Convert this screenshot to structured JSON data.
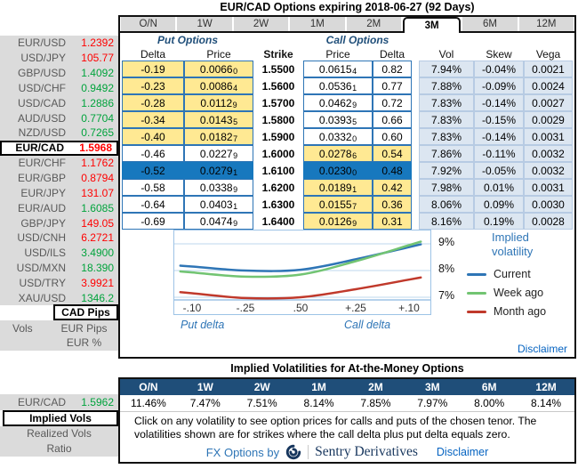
{
  "title": "EUR/CAD Options expiring 2018-06-27 (92 Days)",
  "colors": {
    "selected_row": "#1778BE",
    "itm_yellow": "#FFE993",
    "vol_panel": "#DCE6F1",
    "header_navy": "#1F4E79",
    "up_green": "#00A33C",
    "down_red": "#FF0000",
    "link_blue": "#0563C1"
  },
  "tenor_tabs": {
    "labels": [
      "O/N",
      "1W",
      "2W",
      "1M",
      "2M",
      "3M",
      "6M",
      "12M"
    ],
    "selected": "3M"
  },
  "sidebar": {
    "pairs": [
      {
        "pair": "EUR/USD",
        "rate": "1.2392",
        "dir": "red",
        "selected": false
      },
      {
        "pair": "USD/JPY",
        "rate": "105.77",
        "dir": "red",
        "selected": false
      },
      {
        "pair": "GBP/USD",
        "rate": "1.4092",
        "dir": "green",
        "selected": false
      },
      {
        "pair": "USD/CHF",
        "rate": "0.9492",
        "dir": "green",
        "selected": false
      },
      {
        "pair": "USD/CAD",
        "rate": "1.2886",
        "dir": "green",
        "selected": false
      },
      {
        "pair": "AUD/USD",
        "rate": "0.7704",
        "dir": "green",
        "selected": false
      },
      {
        "pair": "NZD/USD",
        "rate": "0.7265",
        "dir": "green",
        "selected": false
      },
      {
        "pair": "EUR/CAD",
        "rate": "1.5968",
        "dir": "red",
        "selected": true
      },
      {
        "pair": "EUR/CHF",
        "rate": "1.1762",
        "dir": "red",
        "selected": false
      },
      {
        "pair": "EUR/GBP",
        "rate": "0.8794",
        "dir": "red",
        "selected": false
      },
      {
        "pair": "EUR/JPY",
        "rate": "131.07",
        "dir": "red",
        "selected": false
      },
      {
        "pair": "EUR/AUD",
        "rate": "1.6085",
        "dir": "green",
        "selected": false
      },
      {
        "pair": "GBP/JPY",
        "rate": "149.05",
        "dir": "red",
        "selected": false
      },
      {
        "pair": "USD/CNH",
        "rate": "6.2721",
        "dir": "red",
        "selected": false
      },
      {
        "pair": "USD/ILS",
        "rate": "3.4900",
        "dir": "green",
        "selected": false
      },
      {
        "pair": "USD/MXN",
        "rate": "18.390",
        "dir": "green",
        "selected": false
      },
      {
        "pair": "USD/TRY",
        "rate": "3.9921",
        "dir": "red",
        "selected": false
      },
      {
        "pair": "XAU/USD",
        "rate": "1346.2",
        "dir": "green",
        "selected": false
      }
    ],
    "vols_label": "Vols",
    "quote_modes": {
      "selected": "CAD Pips",
      "others": [
        "EUR Pips",
        "EUR %"
      ]
    },
    "bottom_pair": {
      "pair": "EUR/CAD",
      "rate": "1.5962",
      "dir": "green"
    },
    "vol_views": {
      "selected": "Implied Vols",
      "others": [
        "Realized Vols",
        "Ratio"
      ]
    }
  },
  "options_table": {
    "put_group_label": "Put Options",
    "call_group_label": "Call Options",
    "headers": {
      "put_delta": "Delta",
      "put_price": "Price",
      "strike": "Strike",
      "call_price": "Price",
      "call_delta": "Delta",
      "vol": "Vol",
      "skew": "Skew",
      "vega": "Vega"
    },
    "rows": [
      {
        "put_delta": "-0.19",
        "put_price": "0.0066",
        "put_price_sub": "0",
        "strike": "1.5500",
        "call_price": "0.0615",
        "call_price_sub": "4",
        "call_delta": "0.82",
        "vol": "7.94%",
        "skew": "-0.04%",
        "vega": "0.0021",
        "put_itm": true,
        "call_itm": false,
        "selected": false
      },
      {
        "put_delta": "-0.23",
        "put_price": "0.0086",
        "put_price_sub": "4",
        "strike": "1.5600",
        "call_price": "0.0536",
        "call_price_sub": "1",
        "call_delta": "0.77",
        "vol": "7.88%",
        "skew": "-0.09%",
        "vega": "0.0024",
        "put_itm": true,
        "call_itm": false,
        "selected": false
      },
      {
        "put_delta": "-0.28",
        "put_price": "0.0112",
        "put_price_sub": "9",
        "strike": "1.5700",
        "call_price": "0.0462",
        "call_price_sub": "9",
        "call_delta": "0.72",
        "vol": "7.83%",
        "skew": "-0.14%",
        "vega": "0.0027",
        "put_itm": true,
        "call_itm": false,
        "selected": false
      },
      {
        "put_delta": "-0.34",
        "put_price": "0.0143",
        "put_price_sub": "5",
        "strike": "1.5800",
        "call_price": "0.0393",
        "call_price_sub": "5",
        "call_delta": "0.66",
        "vol": "7.83%",
        "skew": "-0.15%",
        "vega": "0.0029",
        "put_itm": true,
        "call_itm": false,
        "selected": false
      },
      {
        "put_delta": "-0.40",
        "put_price": "0.0182",
        "put_price_sub": "7",
        "strike": "1.5900",
        "call_price": "0.0332",
        "call_price_sub": "0",
        "call_delta": "0.60",
        "vol": "7.83%",
        "skew": "-0.14%",
        "vega": "0.0031",
        "put_itm": true,
        "call_itm": false,
        "selected": false
      },
      {
        "put_delta": "-0.46",
        "put_price": "0.0227",
        "put_price_sub": "9",
        "strike": "1.6000",
        "call_price": "0.0278",
        "call_price_sub": "6",
        "call_delta": "0.54",
        "vol": "7.86%",
        "skew": "-0.11%",
        "vega": "0.0032",
        "put_itm": false,
        "call_itm": true,
        "selected": false
      },
      {
        "put_delta": "-0.52",
        "put_price": "0.0279",
        "put_price_sub": "1",
        "strike": "1.6100",
        "call_price": "0.0230",
        "call_price_sub": "0",
        "call_delta": "0.48",
        "vol": "7.92%",
        "skew": "-0.05%",
        "vega": "0.0032",
        "put_itm": false,
        "call_itm": false,
        "selected": true
      },
      {
        "put_delta": "-0.58",
        "put_price": "0.0338",
        "put_price_sub": "9",
        "strike": "1.6200",
        "call_price": "0.0189",
        "call_price_sub": "1",
        "call_delta": "0.42",
        "vol": "7.98%",
        "skew": "0.01%",
        "vega": "0.0031",
        "put_itm": false,
        "call_itm": true,
        "selected": false
      },
      {
        "put_delta": "-0.64",
        "put_price": "0.0403",
        "put_price_sub": "1",
        "strike": "1.6300",
        "call_price": "0.0155",
        "call_price_sub": "7",
        "call_delta": "0.36",
        "vol": "8.06%",
        "skew": "0.09%",
        "vega": "0.0030",
        "put_itm": false,
        "call_itm": true,
        "selected": false
      },
      {
        "put_delta": "-0.69",
        "put_price": "0.0474",
        "put_price_sub": "9",
        "strike": "1.6400",
        "call_price": "0.0126",
        "call_price_sub": "9",
        "call_delta": "0.31",
        "vol": "8.16%",
        "skew": "0.19%",
        "vega": "0.0028",
        "put_itm": false,
        "call_itm": true,
        "selected": false
      }
    ]
  },
  "chart_data": {
    "type": "line",
    "title": "Implied volatility",
    "x_labels": [
      "-.10",
      "-.25",
      ".50",
      "+.25",
      "+.10"
    ],
    "x_axis_left_label": "Put delta",
    "x_axis_right_label": "Call delta",
    "y_ticks": [
      "9%",
      "8%",
      "7%"
    ],
    "y_range": [
      6.5,
      9.5
    ],
    "grid": true,
    "legend_position": "right",
    "series": [
      {
        "name": "Current",
        "color": "#2E75B6",
        "values": [
          8.15,
          8.0,
          8.03,
          8.42,
          8.88
        ]
      },
      {
        "name": "Week ago",
        "color": "#72C472",
        "values": [
          7.93,
          7.77,
          7.85,
          8.35,
          8.95
        ]
      },
      {
        "name": "Month ago",
        "color": "#C0392B",
        "values": [
          7.15,
          6.97,
          7.0,
          7.3,
          7.66
        ]
      }
    ]
  },
  "main_disclaimer": "Disclaimer",
  "atm": {
    "title": "Implied Volatilities for At-the-Money Options",
    "tenors": [
      "O/N",
      "1W",
      "2W",
      "1M",
      "2M",
      "3M",
      "6M",
      "12M"
    ],
    "vols": [
      "11.46%",
      "7.47%",
      "7.51%",
      "8.14%",
      "7.85%",
      "7.97%",
      "8.00%",
      "8.14%"
    ],
    "note": "Click on any volatility to see option prices for calls and puts of the chosen tenor. The volatilities shown are for strikes where the call delta plus put delta equals zero.",
    "footer": {
      "fx_by": "FX Options by",
      "brand": "Sentry Derivatives",
      "disclaimer": "Disclaimer"
    }
  }
}
